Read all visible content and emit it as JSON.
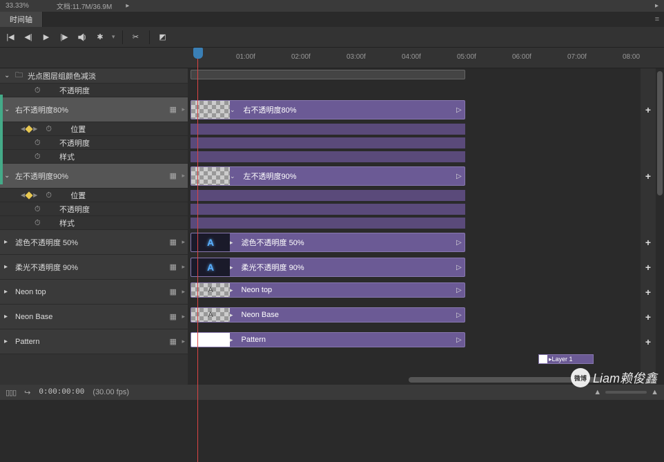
{
  "top": {
    "zoom": "33.33%",
    "doc": "文档:11.7M/36.9M"
  },
  "tab": {
    "name": "时间轴"
  },
  "ruler": {
    "ticks": [
      "01:00f",
      "02:00f",
      "03:00f",
      "04:00f",
      "05:00f",
      "06:00f",
      "07:00f",
      "08:00"
    ]
  },
  "tracks": {
    "group": {
      "name": "光点图层组颜色减淡",
      "opacity": "不透明度"
    },
    "layer1": {
      "name": "右不透明度80%",
      "clip": "右不透明度80%",
      "p1": "位置",
      "p2": "不透明度",
      "p3": "样式"
    },
    "layer2": {
      "name": "左不透明度90%",
      "clip": "左不透明度90%",
      "p1": "位置",
      "p2": "不透明度",
      "p3": "样式"
    },
    "layer3": {
      "name": "滤色不透明度 50%",
      "clip": "滤色不透明度 50%"
    },
    "layer4": {
      "name": "柔光不透明度 90%",
      "clip": "柔光不透明度 90%"
    },
    "layer5": {
      "name": "Neon top",
      "clip": "Neon top"
    },
    "layer6": {
      "name": "Neon Base",
      "clip": "Neon Base"
    },
    "layer7": {
      "name": "Pattern",
      "clip": "Pattern"
    },
    "tiny": "Layer 1"
  },
  "bottom": {
    "timecode": "0:00:00:00",
    "fps": "(30.00 fps)"
  },
  "watermark": "Liam赖俊鑫"
}
